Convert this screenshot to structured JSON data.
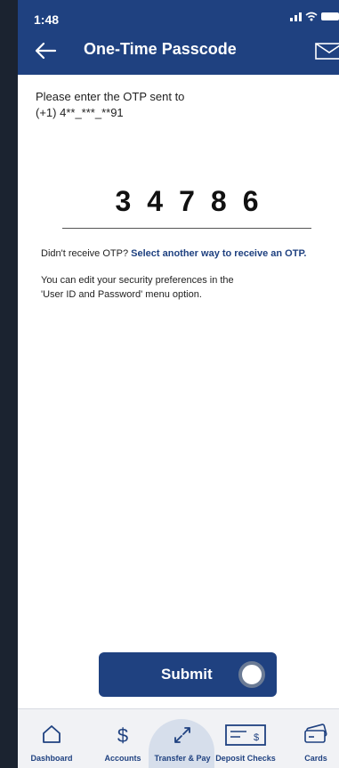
{
  "status": {
    "time": "1:48"
  },
  "header": {
    "title": "One-Time Passcode"
  },
  "instruction": {
    "line1": "Please enter the OTP sent to",
    "line2": "(+1) 4**_***_**91"
  },
  "otp": {
    "value": "34786"
  },
  "resend": {
    "prefix": "Didn't receive OTP?",
    "link": "Select another way to receive an OTP."
  },
  "preferences": {
    "line1": "You can edit your security preferences in the",
    "line2": "'User ID and Password' menu option."
  },
  "submit": {
    "label": "Submit"
  },
  "nav": [
    {
      "label": "Dashboard"
    },
    {
      "label": "Accounts"
    },
    {
      "label": "Transfer & Pay"
    },
    {
      "label": "Deposit Checks"
    },
    {
      "label": "Cards"
    }
  ],
  "colors": {
    "primary": "#1f4180",
    "background": "#ffffff",
    "nav_background": "#f1f2f5",
    "active_tab": "#d6deeb"
  },
  "icons": [
    "back-arrow-icon",
    "mail-icon",
    "home-icon",
    "dollar-icon",
    "transfer-arrows-icon",
    "check-icon",
    "card-icon"
  ]
}
